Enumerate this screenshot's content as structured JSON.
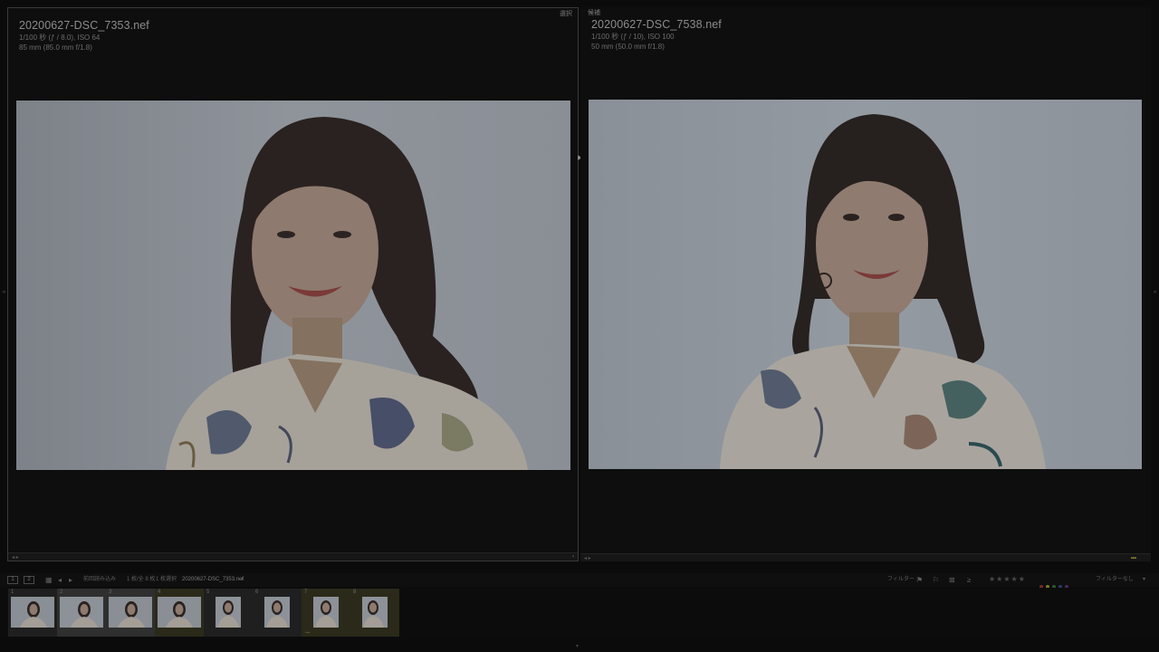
{
  "left": {
    "tag": "選択",
    "filename": "20200627-DSC_7353.nef",
    "exposure": "1/100 秒 (ƒ / 8.0), ISO 64",
    "lens": "85 mm (85.0 mm f/1.8)"
  },
  "right": {
    "tag": "候補",
    "filename": "20200627-DSC_7538.nef",
    "exposure": "1/100 秒 (ƒ / 10), ISO 100",
    "lens": "50 mm (50.0 mm f/1.8)"
  },
  "toolbar": {
    "view1": "1",
    "view2": "2",
    "path": "前回読み込み",
    "count": "1 枚/全 8 枚",
    "selected": "1 枚選択",
    "current_file": "20200627-DSC_7353.nef",
    "filter_label": "フィルター :",
    "filter_value": "フィルターなし",
    "stars": "★★★★★"
  },
  "filmstrip": [
    {
      "num": "1",
      "style": "dark",
      "orientation": "landscape"
    },
    {
      "num": "2",
      "style": "light",
      "orientation": "landscape"
    },
    {
      "num": "3",
      "style": "light",
      "orientation": "landscape"
    },
    {
      "num": "4",
      "style": "olive",
      "orientation": "landscape"
    },
    {
      "num": "5",
      "style": "dark",
      "orientation": "portrait"
    },
    {
      "num": "6",
      "style": "dark",
      "orientation": "portrait"
    },
    {
      "num": "7",
      "style": "olive",
      "orientation": "portrait"
    },
    {
      "num": "8",
      "style": "olive",
      "orientation": "portrait"
    }
  ],
  "colors": {
    "accent_yellow": "#b8a830",
    "label_red": "#7a2a2a",
    "label_yellow": "#7a7a2a",
    "label_green": "#2a5a2a",
    "label_blue": "#2a3a6a",
    "label_purple": "#4a2a5a"
  }
}
